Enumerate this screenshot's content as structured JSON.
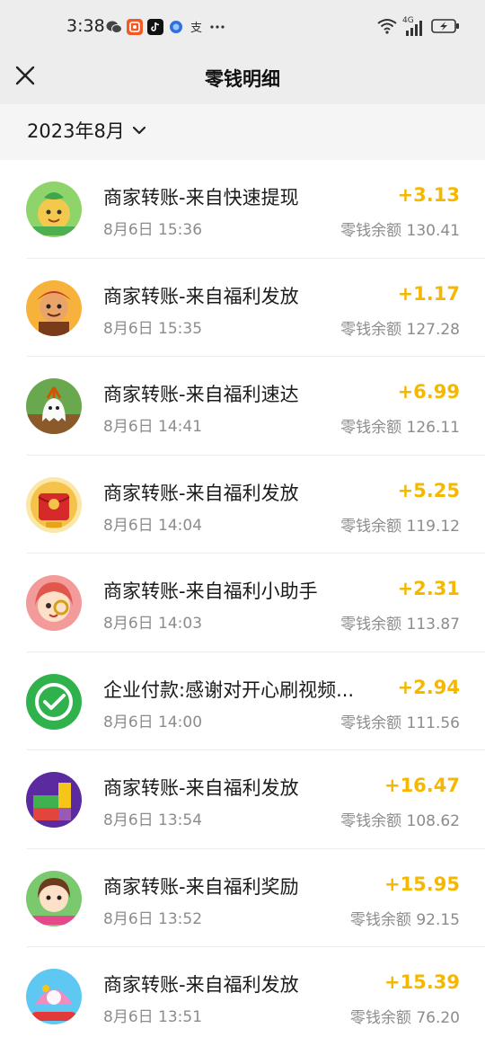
{
  "status_bar": {
    "time": "3:38",
    "left_icons": [
      "wechat-icon",
      "app-icon",
      "tiktok-icon",
      "browser-icon",
      "alipay-icon",
      "more-icon"
    ],
    "right_icons": [
      "wifi-icon",
      "signal-4g-icon",
      "battery-icon"
    ],
    "network": "4G"
  },
  "navbar": {
    "title": "零钱明细",
    "close_icon": "close-icon"
  },
  "filter": {
    "month": "2023年8月",
    "chevron_icon": "chevron-down-icon"
  },
  "transactions": [
    {
      "title": "商家转账-来自快速提现",
      "time": "8月6日 15:36",
      "amount": "+3.13",
      "balance": "零钱余额 130.41",
      "avatar": "cartoon-fruit-avatar"
    },
    {
      "title": "商家转账-来自福利发放",
      "time": "8月6日 15:35",
      "amount": "+1.17",
      "balance": "零钱余额 127.28",
      "avatar": "cartoon-character-avatar"
    },
    {
      "title": "商家转账-来自福利速达",
      "time": "8月6日 14:41",
      "amount": "+6.99",
      "balance": "零钱余额 126.11",
      "avatar": "radish-ghost-avatar"
    },
    {
      "title": "商家转账-来自福利发放",
      "time": "8月6日 14:04",
      "amount": "+5.25",
      "balance": "零钱余额 119.12",
      "avatar": "red-envelope-avatar"
    },
    {
      "title": "商家转账-来自福利小助手",
      "time": "8月6日 14:03",
      "amount": "+2.31",
      "balance": "零钱余额 113.87",
      "avatar": "girl-magnifier-avatar"
    },
    {
      "title": "企业付款:感谢对开心刷视频...",
      "time": "8月6日 14:00",
      "amount": "+2.94",
      "balance": "零钱余额 111.56",
      "avatar": "wechat-pay-avatar"
    },
    {
      "title": "商家转账-来自福利发放",
      "time": "8月6日 13:54",
      "amount": "+16.47",
      "balance": "零钱余额 108.62",
      "avatar": "block-puzzle-avatar"
    },
    {
      "title": "商家转账-来自福利奖励",
      "time": "8月6日 13:52",
      "amount": "+15.95",
      "balance": "零钱余额 92.15",
      "avatar": "girl-flower-avatar"
    },
    {
      "title": "商家转账-来自福利发放",
      "time": "8月6日 13:51",
      "amount": "+15.39",
      "balance": "零钱余额 76.20",
      "avatar": "pearl-shell-avatar"
    }
  ],
  "colors": {
    "amount": "#f5b800",
    "header_bg": "#ededed",
    "month_bar_bg": "#f5f5f5",
    "secondary_text": "#8c8c8c"
  }
}
